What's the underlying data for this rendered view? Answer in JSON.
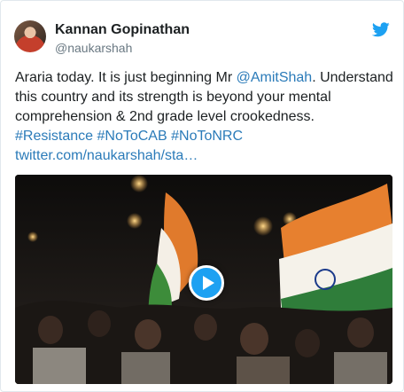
{
  "tweet": {
    "author_name": "Kannan Gopinathan",
    "author_handle": "@naukarshah",
    "text_part1": "Araria today. It is just beginning Mr ",
    "mention": "@AmitShah",
    "text_part2": ". Understand this country and its strength is beyond your mental comprehension & 2nd grade level crookedness.",
    "hashtags": [
      "#Resistance",
      "#NoToCAB",
      "#NoToNRC"
    ],
    "link": "twitter.com/naukarshah/sta…"
  },
  "icons": {
    "twitter_bird": "twitter-bird-icon",
    "play": "play-icon"
  },
  "colors": {
    "link_blue": "#2b7bb9",
    "twitter_blue": "#1da1f2",
    "name_text": "#1c2022",
    "handle_text": "#697882"
  }
}
